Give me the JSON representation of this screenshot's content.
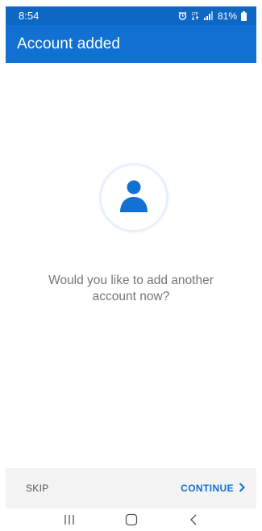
{
  "status_bar": {
    "time": "8:54",
    "battery": "81%",
    "icons": [
      "alarm-icon",
      "lte-icon",
      "signal-icon",
      "battery-icon"
    ],
    "network": "LTE"
  },
  "app_bar": {
    "title": "Account added"
  },
  "main": {
    "avatar_icon": "person-icon",
    "prompt": "Would you like to add another account now?"
  },
  "actions": {
    "skip_label": "SKIP",
    "continue_label": "CONTINUE",
    "continue_icon": "chevron-right-icon"
  },
  "nav_bar": {
    "icons": [
      "recent-apps-icon",
      "home-icon",
      "back-icon"
    ]
  },
  "colors": {
    "accent": "#1071d3",
    "status_bar": "#0f67c4",
    "action_bar_bg": "#f3f3f3",
    "prompt_text": "#757575"
  }
}
